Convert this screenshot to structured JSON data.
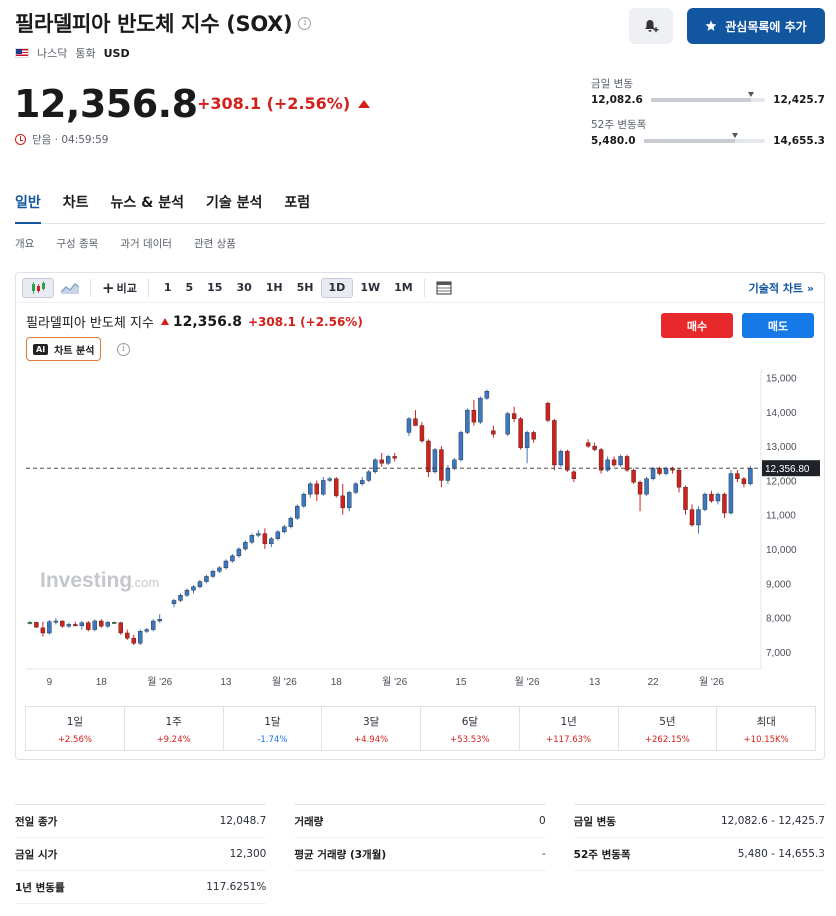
{
  "header": {
    "title": "필라델피아 반도체 지수 (SOX)",
    "exchange": "나스닥",
    "currency_label": "통화",
    "currency": "USD",
    "watchlist_label": "관심목록에 추가"
  },
  "quote": {
    "price": "12,356.8",
    "change": "+308.1 (+2.56%)",
    "status": "닫음 · 04:59:59"
  },
  "ranges": {
    "day": {
      "label": "금일 변동",
      "low": "12,082.6",
      "high": "12,425.7",
      "position": 0.88
    },
    "week52": {
      "label": "52주 변동폭",
      "low": "5,480.0",
      "high": "14,655.3",
      "position": 0.75
    }
  },
  "tabs": [
    "일반",
    "차트",
    "뉴스 & 분석",
    "기술 분석",
    "포럼"
  ],
  "subtabs": [
    "개요",
    "구성 종목",
    "과거 데이터",
    "관련 상품"
  ],
  "chart_toolbar": {
    "compare": "비교",
    "intervals": [
      "1",
      "5",
      "15",
      "30",
      "1H",
      "5H",
      "1D",
      "1W",
      "1M"
    ],
    "active_interval": "1D",
    "technical_link": "기술적 차트 »"
  },
  "chart_header": {
    "name": "필라델피아 반도체 지수",
    "price": "12,356.8",
    "change": "+308.1 (+2.56%)",
    "ai_label": "차트 분석",
    "buy": "매수",
    "sell": "매도",
    "watermark": "Investing",
    "watermark_suffix": ".com"
  },
  "chart_data": {
    "type": "candlestick",
    "ylim": [
      6500,
      15250
    ],
    "yticks": [
      7000,
      8000,
      9000,
      10000,
      11000,
      12000,
      13000,
      14000,
      15000
    ],
    "ytick_labels": [
      "7,000",
      "8,000",
      "9,000",
      "10,000",
      "11,000",
      "12,000",
      "13,000",
      "14,000",
      "15,000"
    ],
    "xtick_labels": [
      "9",
      "18",
      "월 '26",
      "13",
      "월 '26",
      "18",
      "월 '26",
      "15",
      "월 '26",
      "13",
      "22",
      "월 '26"
    ],
    "last_price": 12356.8,
    "last_price_label": "12,356.80",
    "colors": {
      "up": "#3b78c2",
      "down": "#d4201a",
      "doji": "#2e9e4f"
    },
    "candles": [
      [
        7850,
        7900,
        7800,
        7860
      ],
      [
        7860,
        7880,
        7700,
        7720
      ],
      [
        7700,
        7880,
        7450,
        7550
      ],
      [
        7550,
        7930,
        7500,
        7880
      ],
      [
        7880,
        7980,
        7800,
        7900
      ],
      [
        7900,
        7920,
        7700,
        7750
      ],
      [
        7750,
        7850,
        7700,
        7800
      ],
      [
        7800,
        7880,
        7740,
        7760
      ],
      [
        7760,
        7900,
        7650,
        7850
      ],
      [
        7850,
        7900,
        7600,
        7650
      ],
      [
        7650,
        7950,
        7600,
        7900
      ],
      [
        7900,
        7950,
        7700,
        7750
      ],
      [
        7750,
        7900,
        7700,
        7860
      ],
      [
        7860,
        7890,
        7820,
        7850
      ],
      [
        7850,
        7880,
        7500,
        7550
      ],
      [
        7550,
        7650,
        7350,
        7400
      ],
      [
        7400,
        7500,
        7200,
        7250
      ],
      [
        7250,
        7650,
        7200,
        7600
      ],
      [
        7600,
        7700,
        7550,
        7650
      ],
      [
        7650,
        7950,
        7600,
        7900
      ],
      [
        7900,
        8100,
        7850,
        7950
      ],
      [
        8400,
        8550,
        8300,
        8500
      ],
      [
        8500,
        8700,
        8450,
        8650
      ],
      [
        8650,
        8850,
        8600,
        8800
      ],
      [
        8800,
        8950,
        8700,
        8900
      ],
      [
        8900,
        9100,
        8850,
        9050
      ],
      [
        9050,
        9250,
        9000,
        9200
      ],
      [
        9200,
        9400,
        9150,
        9350
      ],
      [
        9350,
        9500,
        9300,
        9450
      ],
      [
        9450,
        9700,
        9400,
        9650
      ],
      [
        9650,
        9850,
        9600,
        9800
      ],
      [
        9800,
        10050,
        9750,
        10000
      ],
      [
        10000,
        10250,
        9950,
        10200
      ],
      [
        10200,
        10450,
        10150,
        10400
      ],
      [
        10400,
        10550,
        10350,
        10450
      ],
      [
        10450,
        10600,
        10000,
        10150
      ],
      [
        10150,
        10350,
        10050,
        10300
      ],
      [
        10300,
        10550,
        10250,
        10500
      ],
      [
        10500,
        10700,
        10450,
        10650
      ],
      [
        10650,
        10950,
        10600,
        10900
      ],
      [
        10900,
        11300,
        10850,
        11250
      ],
      [
        11250,
        11650,
        11200,
        11600
      ],
      [
        11600,
        11950,
        11500,
        11900
      ],
      [
        11900,
        12000,
        11400,
        11600
      ],
      [
        11600,
        12100,
        11550,
        12000
      ],
      [
        12000,
        12100,
        11950,
        12050
      ],
      [
        12050,
        12100,
        11500,
        11550
      ],
      [
        11550,
        11900,
        11000,
        11200
      ],
      [
        11200,
        11700,
        11100,
        11650
      ],
      [
        11650,
        11950,
        11600,
        11900
      ],
      [
        11900,
        12100,
        11850,
        12000
      ],
      [
        12000,
        12300,
        11950,
        12250
      ],
      [
        12250,
        12650,
        12200,
        12600
      ],
      [
        12600,
        12800,
        12400,
        12500
      ],
      [
        12500,
        12750,
        12450,
        12700
      ],
      [
        12700,
        12800,
        12550,
        12650
      ],
      [
        13400,
        13850,
        13300,
        13800
      ],
      [
        13800,
        14050,
        13700,
        13600
      ],
      [
        13600,
        13700,
        13100,
        13150
      ],
      [
        13150,
        13200,
        12100,
        12250
      ],
      [
        12250,
        12950,
        12200,
        12900
      ],
      [
        12900,
        13000,
        11800,
        12000
      ],
      [
        12000,
        12450,
        11900,
        12350
      ],
      [
        12350,
        12650,
        12300,
        12600
      ],
      [
        12600,
        13450,
        12550,
        13400
      ],
      [
        13400,
        14100,
        13350,
        14050
      ],
      [
        14050,
        14350,
        13600,
        13700
      ],
      [
        13700,
        14450,
        13650,
        14400
      ],
      [
        14400,
        14650,
        14350,
        14600
      ],
      [
        13450,
        13600,
        13250,
        13350
      ],
      [
        13350,
        14000,
        13300,
        13950
      ],
      [
        13950,
        14150,
        13700,
        13800
      ],
      [
        13800,
        13850,
        12900,
        12950
      ],
      [
        12950,
        13450,
        12500,
        13400
      ],
      [
        13400,
        13450,
        13100,
        13200
      ],
      [
        14250,
        14300,
        13700,
        13750
      ],
      [
        13750,
        13800,
        12300,
        12450
      ],
      [
        12450,
        12900,
        12400,
        12850
      ],
      [
        12850,
        12900,
        12250,
        12300
      ],
      [
        12250,
        12300,
        11950,
        12050
      ],
      [
        13100,
        13200,
        12950,
        13000
      ],
      [
        13000,
        13100,
        12850,
        12900
      ],
      [
        12900,
        12950,
        12200,
        12300
      ],
      [
        12300,
        12700,
        12250,
        12600
      ],
      [
        12600,
        12700,
        12400,
        12450
      ],
      [
        12450,
        12750,
        12400,
        12700
      ],
      [
        12700,
        12750,
        12250,
        12300
      ],
      [
        12300,
        12350,
        11900,
        11950
      ],
      [
        11950,
        12000,
        11100,
        11600
      ],
      [
        11600,
        12100,
        11550,
        12050
      ],
      [
        12050,
        12400,
        12000,
        12350
      ],
      [
        12350,
        12400,
        12150,
        12200
      ],
      [
        12200,
        12400,
        12150,
        12350
      ],
      [
        12350,
        12400,
        12200,
        12300
      ],
      [
        12300,
        12350,
        11650,
        11800
      ],
      [
        11800,
        11850,
        11000,
        11150
      ],
      [
        11150,
        11300,
        10650,
        10700
      ],
      [
        10700,
        11250,
        10450,
        11150
      ],
      [
        11150,
        11650,
        11100,
        11600
      ],
      [
        11600,
        11700,
        11350,
        11400
      ],
      [
        11400,
        11650,
        11300,
        11600
      ],
      [
        11600,
        11650,
        10900,
        11050
      ],
      [
        11050,
        12300,
        11000,
        12200
      ],
      [
        12200,
        12300,
        11950,
        12050
      ],
      [
        12050,
        12100,
        11800,
        11900
      ],
      [
        11900,
        12425,
        11850,
        12356.8
      ]
    ],
    "gaps_after": [
      20,
      55,
      69,
      74,
      79
    ]
  },
  "performance": [
    {
      "label": "1일",
      "value": "+2.56%",
      "dir": "pos"
    },
    {
      "label": "1주",
      "value": "+9.24%",
      "dir": "pos"
    },
    {
      "label": "1달",
      "value": "-1.74%",
      "dir": "neg"
    },
    {
      "label": "3달",
      "value": "+4.94%",
      "dir": "pos"
    },
    {
      "label": "6달",
      "value": "+53.53%",
      "dir": "pos"
    },
    {
      "label": "1년",
      "value": "+117.63%",
      "dir": "pos"
    },
    {
      "label": "5년",
      "value": "+262.15%",
      "dir": "pos"
    },
    {
      "label": "최대",
      "value": "+10.15K%",
      "dir": "pos"
    }
  ],
  "stats": {
    "col1": [
      {
        "k": "전일 종가",
        "v": "12,048.7"
      },
      {
        "k": "금일 시가",
        "v": "12,300"
      },
      {
        "k": "1년 변동률",
        "v": "117.6251%"
      }
    ],
    "col2": [
      {
        "k": "거래량",
        "v": "0"
      },
      {
        "k": "평균 거래량 (3개월)",
        "v": "-"
      }
    ],
    "col3": [
      {
        "k": "금일 변동",
        "v": "12,082.6 - 12,425.7"
      },
      {
        "k": "52주 변동폭",
        "v": "5,480 - 14,655.3"
      }
    ]
  }
}
